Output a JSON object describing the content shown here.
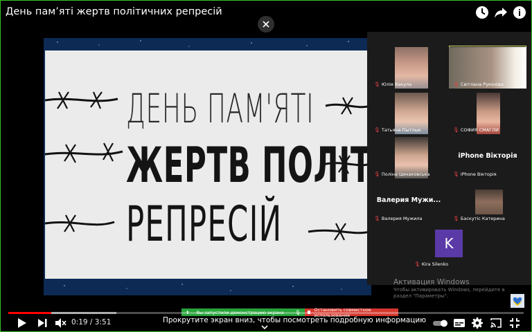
{
  "video": {
    "title": "День пам’яті жертв політичних репресій",
    "progress_fraction": 0.083,
    "buffer_fraction": 0.21,
    "current_time": "0:19",
    "duration": "3:51",
    "time_display": "0:19 / 3:51",
    "scroll_hint": "Прокрутите экран вниз, чтобы посмотреть подробную информацию"
  },
  "slide": {
    "line1": "ДЕНЬ ПАМ'ЯТІ",
    "line2": "ЖЕРТВ ПОЛІТИЧ",
    "line3": "РЕПРЕСІЙ"
  },
  "participants": [
    {
      "name": "Юлія Вакула",
      "video": true
    },
    {
      "name": "Світлана Рукінова",
      "video": true,
      "active": true
    },
    {
      "name": "Татьяна Пытлык",
      "video": true
    },
    {
      "name": "СОФИЯ СМАГЛИ",
      "video": true
    },
    {
      "name": "Поліна Цинаковська",
      "video": true
    },
    {
      "name": "iPhone Вікторія",
      "video": false,
      "display_name": "iPhone Вікторія"
    },
    {
      "name": "Валерия Мужила",
      "video": false,
      "display_name": "Валерия  Мужи..."
    },
    {
      "name": "Баскутіс Катерина",
      "video": true
    },
    {
      "name": "Kira Silenko",
      "video": false,
      "initial": "K"
    }
  ],
  "windows_watermark": {
    "title": "Активация Windows",
    "subtitle": "Чтобы активировать Windows, перейдите в раздел \"Параметры\"."
  },
  "share_bar": {
    "status": "Вы запустили демонстрацию экрана",
    "stop": "Остановить совместное использование"
  },
  "colors": {
    "progress": "#ff0000",
    "share_green": "#27a33a",
    "share_red": "#d4372d",
    "avatar_kira": "#5a3aa6",
    "frame_border": "#39c32c"
  },
  "icons": {
    "top": [
      "watch-later-icon",
      "share-icon",
      "info-icon"
    ],
    "controls_left": [
      "play-icon",
      "next-icon",
      "mute-icon"
    ],
    "controls_right": [
      "autoplay-toggle",
      "subtitles-icon",
      "settings-icon",
      "cast-icon",
      "fullscreen-icon"
    ]
  }
}
